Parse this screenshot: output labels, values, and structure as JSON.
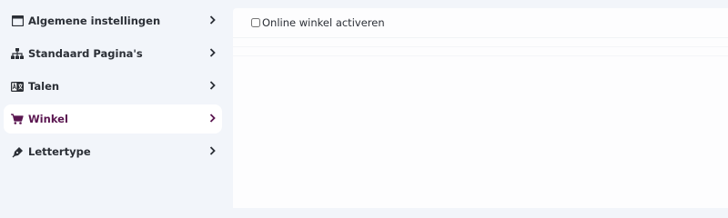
{
  "sidebar": {
    "items": [
      {
        "label": "Algemene instellingen",
        "icon": "window-icon",
        "active": false
      },
      {
        "label": "Standaard Pagina's",
        "icon": "sitemap-icon",
        "active": false
      },
      {
        "label": "Talen",
        "icon": "language-icon",
        "active": false
      },
      {
        "label": "Winkel",
        "icon": "shopping-cart-icon",
        "active": true
      },
      {
        "label": "Lettertype",
        "icon": "pen-nib-icon",
        "active": false
      }
    ]
  },
  "main": {
    "shop_toggle_label": "Online winkel activeren",
    "shop_toggle_checked": false
  },
  "colors": {
    "accent": "#5a1650",
    "sidebar_bg": "#f2f5fa",
    "text": "#2b2f36"
  }
}
